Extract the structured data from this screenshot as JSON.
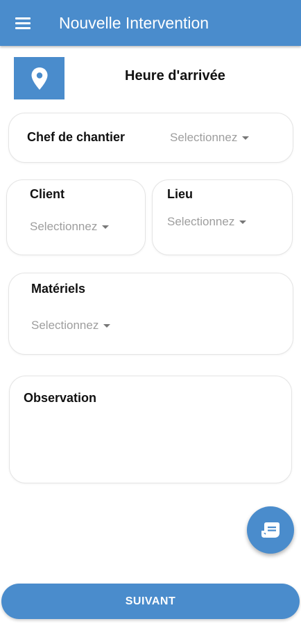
{
  "appbar": {
    "title": "Nouvelle Intervention",
    "menu_icon": "menu-icon"
  },
  "location": {
    "icon": "location-pin-icon",
    "label": "Heure d'arrivée"
  },
  "chef": {
    "label": "Chef de chantier",
    "value": "Selectionnez"
  },
  "client": {
    "label": "Client",
    "value": "Selectionnez"
  },
  "lieu": {
    "label": "Lieu",
    "value": "Selectionnez"
  },
  "materiels": {
    "label": "Matériels",
    "value": "Selectionnez"
  },
  "observation": {
    "label": "Observation",
    "value": ""
  },
  "fab": {
    "icon": "note-icon"
  },
  "footer": {
    "next_label": "SUIVANT"
  },
  "colors": {
    "primary": "#4a8ccc",
    "placeholder": "#9e9e9e"
  }
}
